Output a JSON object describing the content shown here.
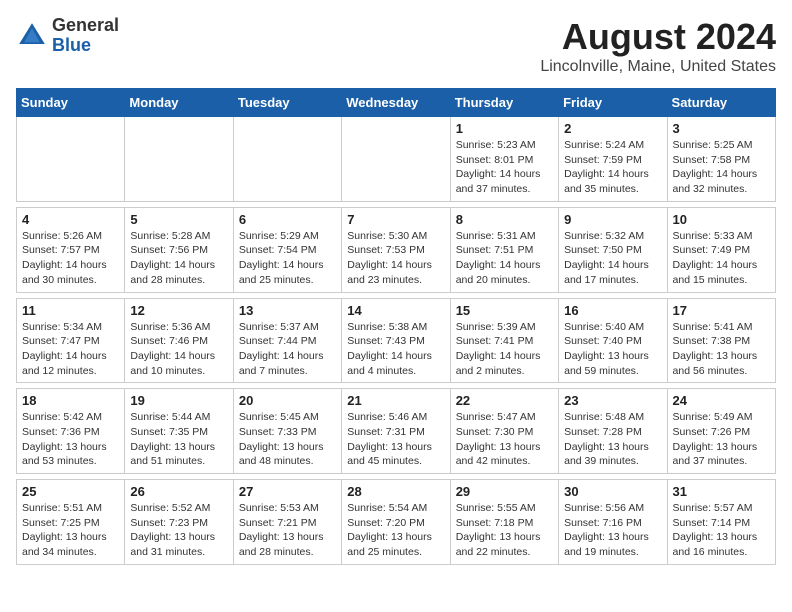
{
  "logo": {
    "general": "General",
    "blue": "Blue"
  },
  "title": "August 2024",
  "subtitle": "Lincolnville, Maine, United States",
  "days_of_week": [
    "Sunday",
    "Monday",
    "Tuesday",
    "Wednesday",
    "Thursday",
    "Friday",
    "Saturday"
  ],
  "weeks": [
    [
      {
        "day": "",
        "info": ""
      },
      {
        "day": "",
        "info": ""
      },
      {
        "day": "",
        "info": ""
      },
      {
        "day": "",
        "info": ""
      },
      {
        "day": "1",
        "info": "Sunrise: 5:23 AM\nSunset: 8:01 PM\nDaylight: 14 hours and 37 minutes."
      },
      {
        "day": "2",
        "info": "Sunrise: 5:24 AM\nSunset: 7:59 PM\nDaylight: 14 hours and 35 minutes."
      },
      {
        "day": "3",
        "info": "Sunrise: 5:25 AM\nSunset: 7:58 PM\nDaylight: 14 hours and 32 minutes."
      }
    ],
    [
      {
        "day": "4",
        "info": "Sunrise: 5:26 AM\nSunset: 7:57 PM\nDaylight: 14 hours and 30 minutes."
      },
      {
        "day": "5",
        "info": "Sunrise: 5:28 AM\nSunset: 7:56 PM\nDaylight: 14 hours and 28 minutes."
      },
      {
        "day": "6",
        "info": "Sunrise: 5:29 AM\nSunset: 7:54 PM\nDaylight: 14 hours and 25 minutes."
      },
      {
        "day": "7",
        "info": "Sunrise: 5:30 AM\nSunset: 7:53 PM\nDaylight: 14 hours and 23 minutes."
      },
      {
        "day": "8",
        "info": "Sunrise: 5:31 AM\nSunset: 7:51 PM\nDaylight: 14 hours and 20 minutes."
      },
      {
        "day": "9",
        "info": "Sunrise: 5:32 AM\nSunset: 7:50 PM\nDaylight: 14 hours and 17 minutes."
      },
      {
        "day": "10",
        "info": "Sunrise: 5:33 AM\nSunset: 7:49 PM\nDaylight: 14 hours and 15 minutes."
      }
    ],
    [
      {
        "day": "11",
        "info": "Sunrise: 5:34 AM\nSunset: 7:47 PM\nDaylight: 14 hours and 12 minutes."
      },
      {
        "day": "12",
        "info": "Sunrise: 5:36 AM\nSunset: 7:46 PM\nDaylight: 14 hours and 10 minutes."
      },
      {
        "day": "13",
        "info": "Sunrise: 5:37 AM\nSunset: 7:44 PM\nDaylight: 14 hours and 7 minutes."
      },
      {
        "day": "14",
        "info": "Sunrise: 5:38 AM\nSunset: 7:43 PM\nDaylight: 14 hours and 4 minutes."
      },
      {
        "day": "15",
        "info": "Sunrise: 5:39 AM\nSunset: 7:41 PM\nDaylight: 14 hours and 2 minutes."
      },
      {
        "day": "16",
        "info": "Sunrise: 5:40 AM\nSunset: 7:40 PM\nDaylight: 13 hours and 59 minutes."
      },
      {
        "day": "17",
        "info": "Sunrise: 5:41 AM\nSunset: 7:38 PM\nDaylight: 13 hours and 56 minutes."
      }
    ],
    [
      {
        "day": "18",
        "info": "Sunrise: 5:42 AM\nSunset: 7:36 PM\nDaylight: 13 hours and 53 minutes."
      },
      {
        "day": "19",
        "info": "Sunrise: 5:44 AM\nSunset: 7:35 PM\nDaylight: 13 hours and 51 minutes."
      },
      {
        "day": "20",
        "info": "Sunrise: 5:45 AM\nSunset: 7:33 PM\nDaylight: 13 hours and 48 minutes."
      },
      {
        "day": "21",
        "info": "Sunrise: 5:46 AM\nSunset: 7:31 PM\nDaylight: 13 hours and 45 minutes."
      },
      {
        "day": "22",
        "info": "Sunrise: 5:47 AM\nSunset: 7:30 PM\nDaylight: 13 hours and 42 minutes."
      },
      {
        "day": "23",
        "info": "Sunrise: 5:48 AM\nSunset: 7:28 PM\nDaylight: 13 hours and 39 minutes."
      },
      {
        "day": "24",
        "info": "Sunrise: 5:49 AM\nSunset: 7:26 PM\nDaylight: 13 hours and 37 minutes."
      }
    ],
    [
      {
        "day": "25",
        "info": "Sunrise: 5:51 AM\nSunset: 7:25 PM\nDaylight: 13 hours and 34 minutes."
      },
      {
        "day": "26",
        "info": "Sunrise: 5:52 AM\nSunset: 7:23 PM\nDaylight: 13 hours and 31 minutes."
      },
      {
        "day": "27",
        "info": "Sunrise: 5:53 AM\nSunset: 7:21 PM\nDaylight: 13 hours and 28 minutes."
      },
      {
        "day": "28",
        "info": "Sunrise: 5:54 AM\nSunset: 7:20 PM\nDaylight: 13 hours and 25 minutes."
      },
      {
        "day": "29",
        "info": "Sunrise: 5:55 AM\nSunset: 7:18 PM\nDaylight: 13 hours and 22 minutes."
      },
      {
        "day": "30",
        "info": "Sunrise: 5:56 AM\nSunset: 7:16 PM\nDaylight: 13 hours and 19 minutes."
      },
      {
        "day": "31",
        "info": "Sunrise: 5:57 AM\nSunset: 7:14 PM\nDaylight: 13 hours and 16 minutes."
      }
    ]
  ]
}
